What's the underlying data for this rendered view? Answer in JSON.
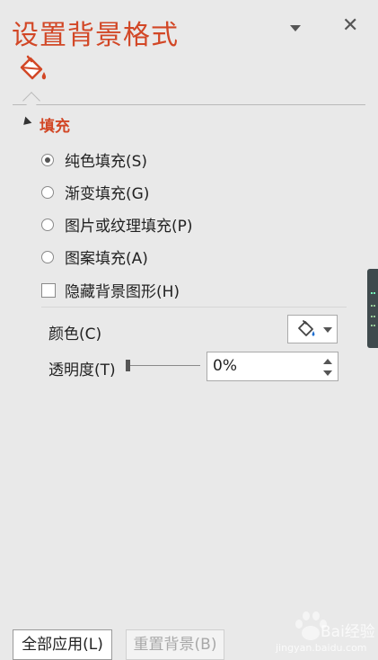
{
  "pane": {
    "title": "设置背景格式",
    "accent": "#d24726"
  },
  "section": {
    "title": "填充"
  },
  "fill_options": [
    {
      "label": "纯色填充(S)",
      "checked": true
    },
    {
      "label": "渐变填充(G)",
      "checked": false
    },
    {
      "label": "图片或纹理填充(P)",
      "checked": false
    },
    {
      "label": "图案填充(A)",
      "checked": false
    }
  ],
  "hide_bg": {
    "label": "隐藏背景图形(H)",
    "checked": false
  },
  "color": {
    "label": "颜色(C)"
  },
  "transparency": {
    "label": "透明度(T)",
    "value": "0%",
    "percent": 0
  },
  "footer": {
    "apply_all": "全部应用(L)",
    "reset": "重置背景(B)"
  },
  "watermark": {
    "brand": "Bai",
    "brand_suffix": "经验",
    "url": "jingyan.baidu.com"
  }
}
